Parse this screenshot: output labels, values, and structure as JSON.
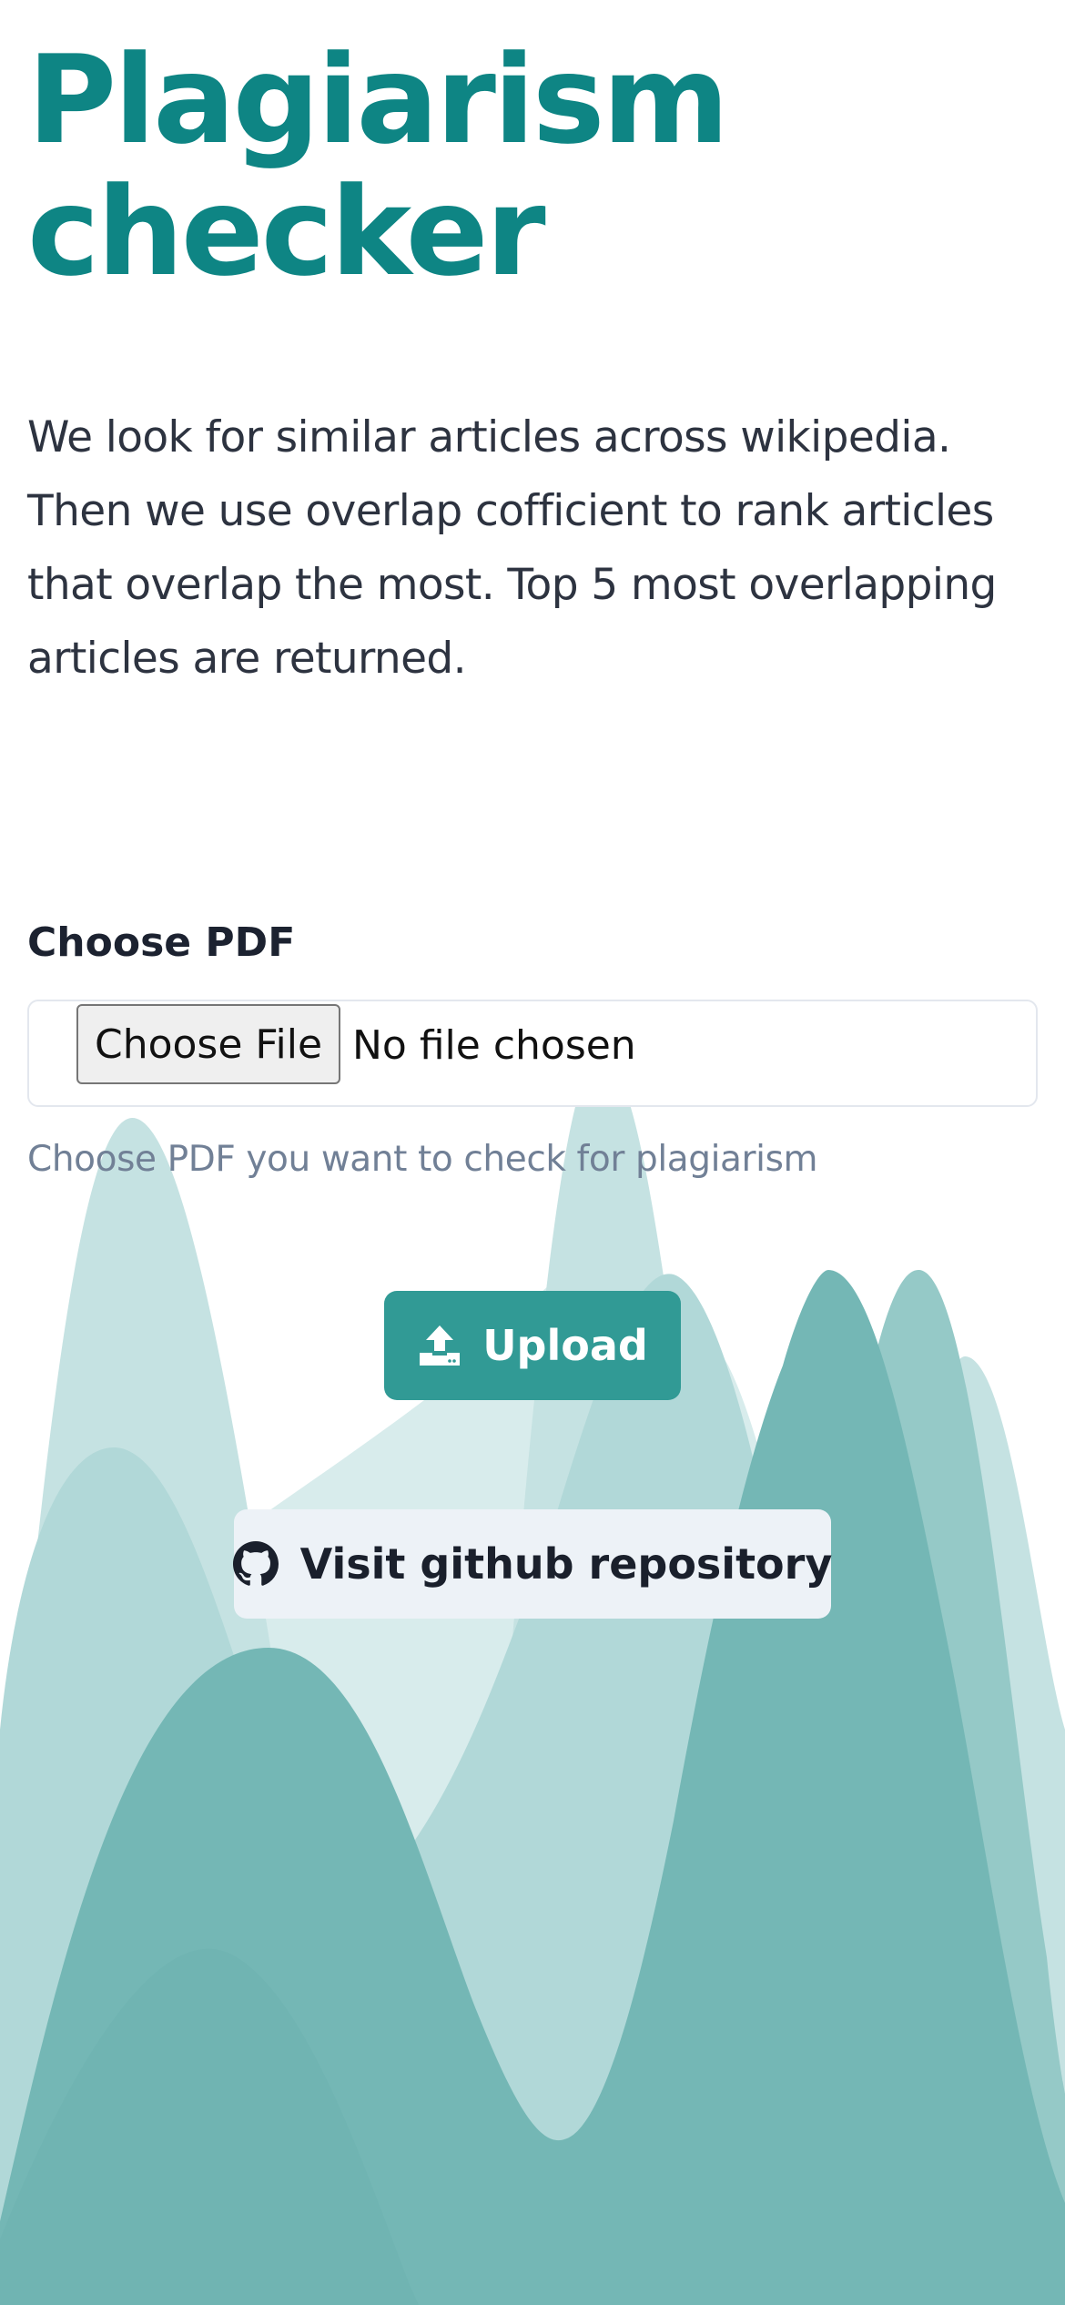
{
  "header": {
    "title_line1": "Plagiarism",
    "title_line2": "checker"
  },
  "intro": {
    "description": "We look for similar articles across wikipedia. Then we use overlap cofficient to rank articles that overlap the most. Top 5 most overlapping articles are returned."
  },
  "form": {
    "label": "Choose PDF",
    "file_button_label": "Choose File",
    "file_status": "No file chosen",
    "helper_text": "Choose PDF you want to check for plagiarism"
  },
  "actions": {
    "upload_label": "Upload",
    "upload_icon": "upload-icon",
    "github_label": "Visit github repository",
    "github_icon": "github-icon"
  },
  "colors": {
    "title": "#0e8584",
    "accent": "#319a95",
    "secondary_button": "#edf2f7",
    "helper_text": "#718096",
    "wave_light": "#c9e4e4",
    "wave_dark": "#70b5b3"
  }
}
